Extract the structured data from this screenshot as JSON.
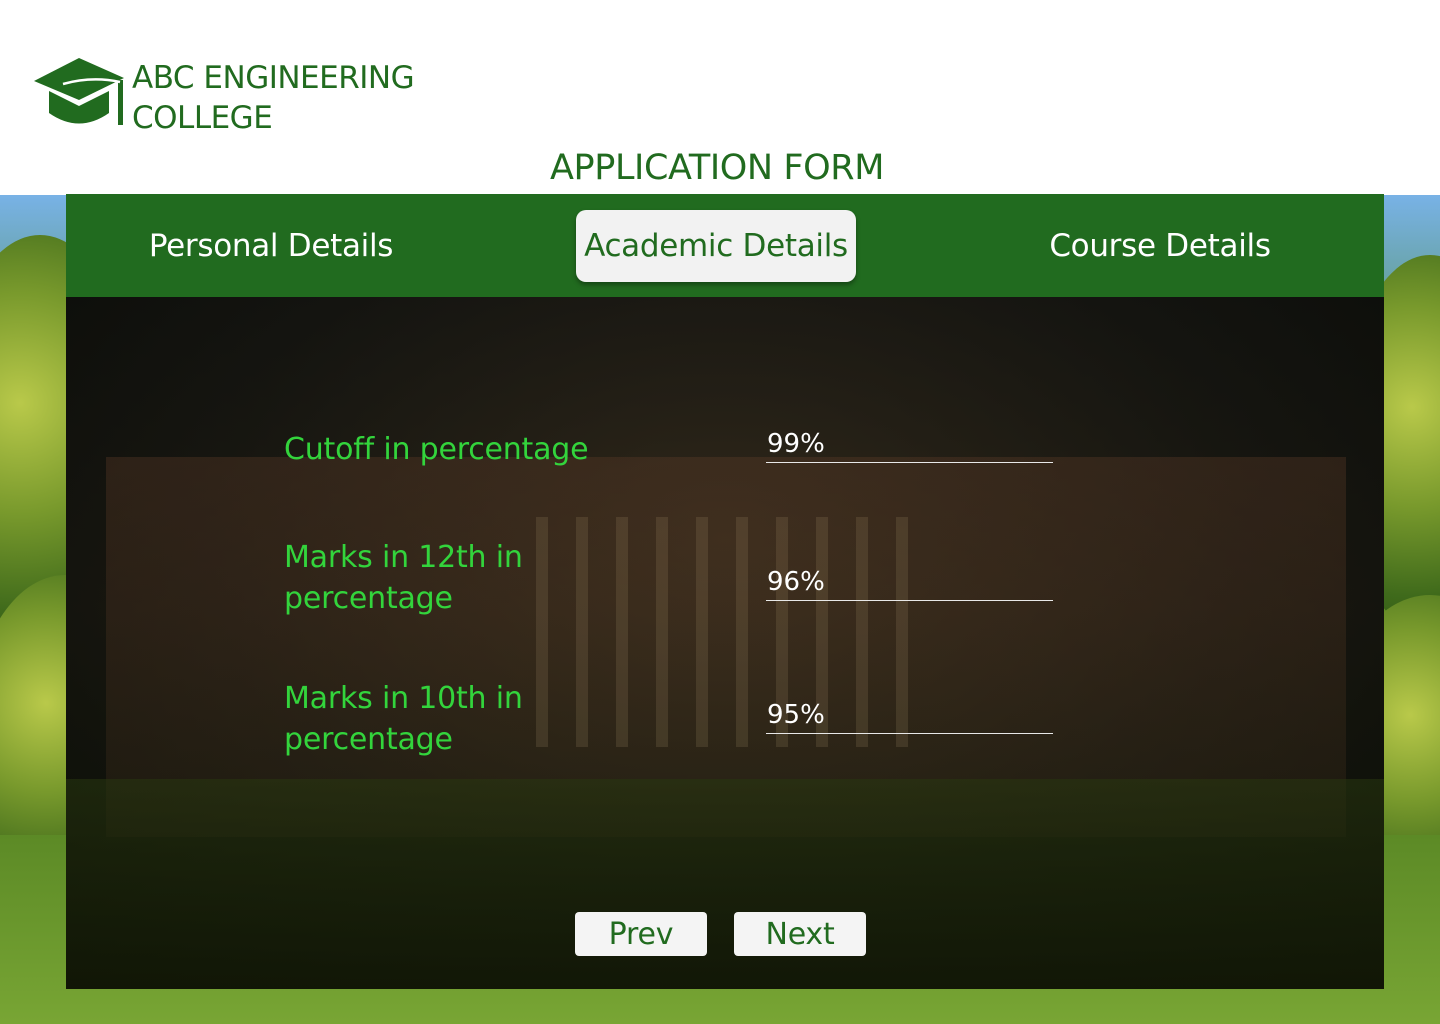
{
  "header": {
    "brand_line1": "ABC ENGINEERING",
    "brand_line2": "COLLEGE",
    "logo_icon": "graduation-cap-icon",
    "page_title": "APPLICATION FORM"
  },
  "tabs": [
    {
      "label": "Personal Details",
      "active": false
    },
    {
      "label": "Academic Details",
      "active": true
    },
    {
      "label": "Course Details",
      "active": false
    }
  ],
  "form": {
    "fields": [
      {
        "label": "Cutoff in percentage",
        "value": "99%"
      },
      {
        "label": "Marks in 12th in percentage",
        "value": "96%"
      },
      {
        "label": "Marks in 10th in percentage",
        "value": "95%"
      }
    ]
  },
  "nav": {
    "prev_label": "Prev",
    "next_label": "Next"
  },
  "colors": {
    "brand_green": "#216b1f",
    "label_green": "#33d43c",
    "tab_active_bg": "#f2f2f2"
  }
}
